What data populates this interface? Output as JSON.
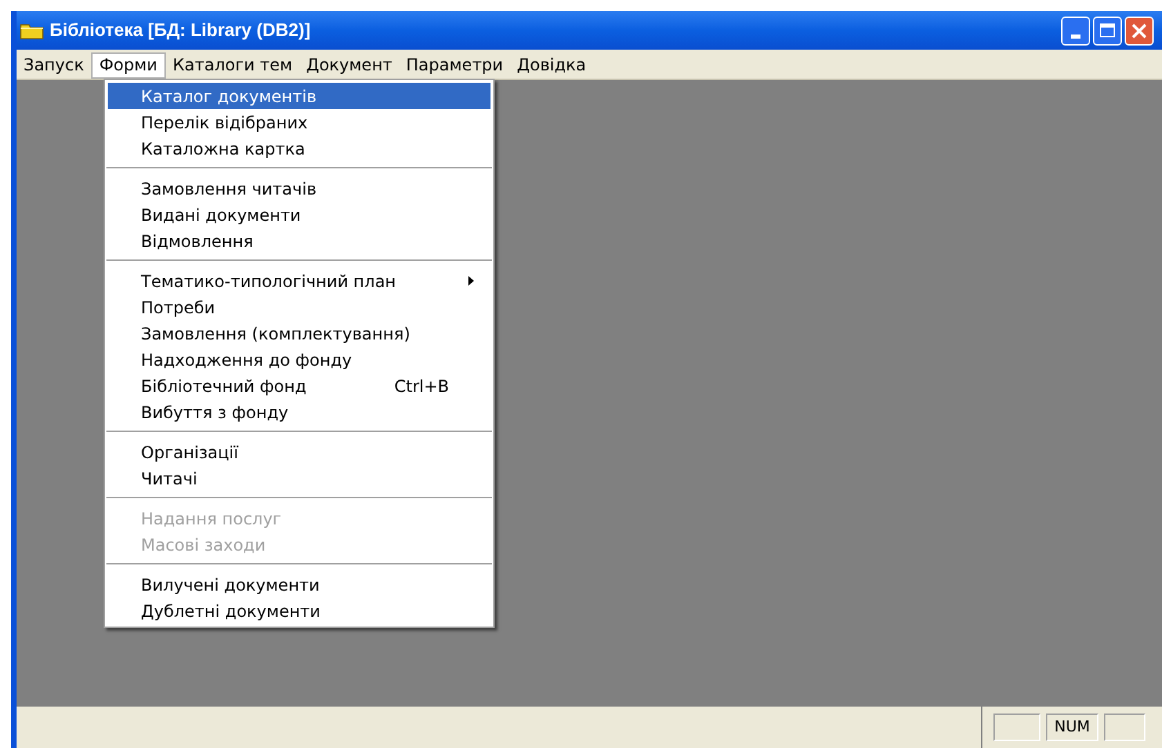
{
  "window": {
    "title": "Бібліотека [БД: Library (DB2)]"
  },
  "menu_bar": [
    {
      "label": "Запуск",
      "selected": false
    },
    {
      "label": "Форми",
      "selected": true
    },
    {
      "label": "Каталоги тем",
      "selected": false
    },
    {
      "label": "Документ",
      "selected": false
    },
    {
      "label": "Параметри",
      "selected": false
    },
    {
      "label": "Довідка",
      "selected": false
    }
  ],
  "dropdown": [
    {
      "kind": "item",
      "label": "Каталог документів",
      "selected": true,
      "disabled": false
    },
    {
      "kind": "item",
      "label": "Перелік відібраних",
      "selected": false,
      "disabled": false
    },
    {
      "kind": "item",
      "label": "Каталожна картка",
      "selected": false,
      "disabled": false
    },
    {
      "kind": "separator"
    },
    {
      "kind": "item",
      "label": "Замовлення читачів",
      "selected": false,
      "disabled": false
    },
    {
      "kind": "item",
      "label": "Видані документи",
      "selected": false,
      "disabled": false
    },
    {
      "kind": "item",
      "label": "Відмовлення",
      "selected": false,
      "disabled": false
    },
    {
      "kind": "separator"
    },
    {
      "kind": "submenu",
      "label": "Тематико-типологічний план",
      "selected": false,
      "disabled": false
    },
    {
      "kind": "item",
      "label": "Потреби",
      "selected": false,
      "disabled": false
    },
    {
      "kind": "item",
      "label": "Замовлення (комплектування)",
      "selected": false,
      "disabled": false
    },
    {
      "kind": "item",
      "label": "Надходження до фонду",
      "selected": false,
      "disabled": false
    },
    {
      "kind": "item",
      "label": "Бібліотечний фонд",
      "shortcut": "Ctrl+B",
      "selected": false,
      "disabled": false
    },
    {
      "kind": "item",
      "label": "Вибуття з фонду",
      "selected": false,
      "disabled": false
    },
    {
      "kind": "separator"
    },
    {
      "kind": "item",
      "label": "Організації",
      "selected": false,
      "disabled": false
    },
    {
      "kind": "item",
      "label": "Читачі",
      "selected": false,
      "disabled": false
    },
    {
      "kind": "separator"
    },
    {
      "kind": "item",
      "label": "Надання послуг",
      "selected": false,
      "disabled": true
    },
    {
      "kind": "item",
      "label": "Масові заходи",
      "selected": false,
      "disabled": true
    },
    {
      "kind": "separator"
    },
    {
      "kind": "item",
      "label": "Вилучені документи",
      "selected": false,
      "disabled": false
    },
    {
      "kind": "item",
      "label": "Дублетні документи",
      "selected": false,
      "disabled": false
    }
  ],
  "status_bar": {
    "indicator": "NUM"
  }
}
